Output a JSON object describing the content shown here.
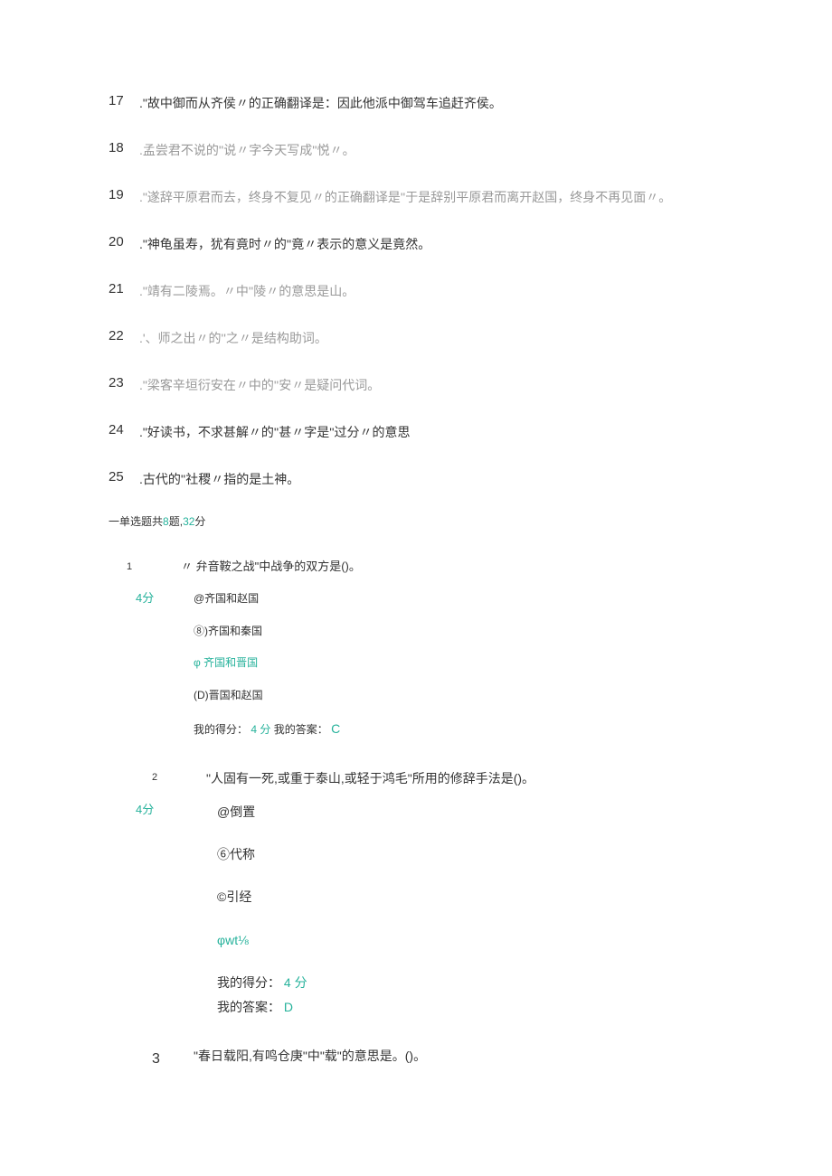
{
  "tf": [
    {
      "num": "17",
      "text": ".\"故中御而从齐侯〃的正确翻译是：因此他派中御驾车追赶齐侯。",
      "gray": false
    },
    {
      "num": "18",
      "text": ".孟尝君不说的''说〃字今天写成''悦〃。",
      "gray": true
    },
    {
      "num": "19",
      "text": ".\"遂辞平原君而去，终身不复见〃的正确翻译是''于是辞别平原君而离开赵国，终身不再见面〃。",
      "gray": true
    },
    {
      "num": "20",
      "text": ".\"神龟虽寿，犹有竟时〃的''竟〃表示的意义是竟然。",
      "gray": false
    },
    {
      "num": "21",
      "text": ".\"靖有二陵焉。〃中''陵〃的意思是山。",
      "gray": true
    },
    {
      "num": "22",
      "text": ".'、师之出〃的''之〃是结构助词。",
      "gray": true
    },
    {
      "num": "23",
      "text": ".\"梁客辛垣衍安在〃中的''安〃是疑问代词。",
      "gray": true
    },
    {
      "num": "24",
      "text": ".\"好读书，不求甚解〃的''甚〃字是''过分〃的意思",
      "gray": false
    },
    {
      "num": "25",
      "text": ".古代的''社稷〃指的是土神。",
      "gray": false
    }
  ],
  "section": {
    "prefix": "一单选题",
    "middle_a": "共",
    "count": "8",
    "middle_b": "题,",
    "points": "32",
    "suffix": "分"
  },
  "mc": [
    {
      "num": "1",
      "q": "〃 弁音鞍之战\"中战争的双方是()。",
      "score": "4分",
      "opts": [
        {
          "t": "@齐国和赵国",
          "green": false
        },
        {
          "t": "⑧)齐国和秦国",
          "green": false
        },
        {
          "t": "φ 齐国和晋国",
          "green": true
        },
        {
          "t": "(D)晋国和赵国",
          "green": false
        }
      ],
      "result_score_label": "我的得分：",
      "result_score": "4 分",
      "result_ans_label": "我的答案：",
      "result_ans": "C",
      "inline_result": true
    },
    {
      "num": "2",
      "q": "\"人固有一死,或重于泰山,或轻于鸿毛\"所用的修辞手法是()。",
      "score": "4分",
      "opts": [
        {
          "t": "@倒置",
          "green": false
        },
        {
          "t": "⑥代称",
          "green": false
        },
        {
          "t": "©引经",
          "green": false
        },
        {
          "t": "φwt⅛",
          "green": true
        }
      ],
      "result_score_label": "我的得分：",
      "result_score": "4 分",
      "result_ans_label": "我的答案：",
      "result_ans": "D",
      "inline_result": false
    },
    {
      "num": "3",
      "q": "\"春日载阳,有鸣仓庚\"中\"载\"的意思是。()。"
    }
  ]
}
